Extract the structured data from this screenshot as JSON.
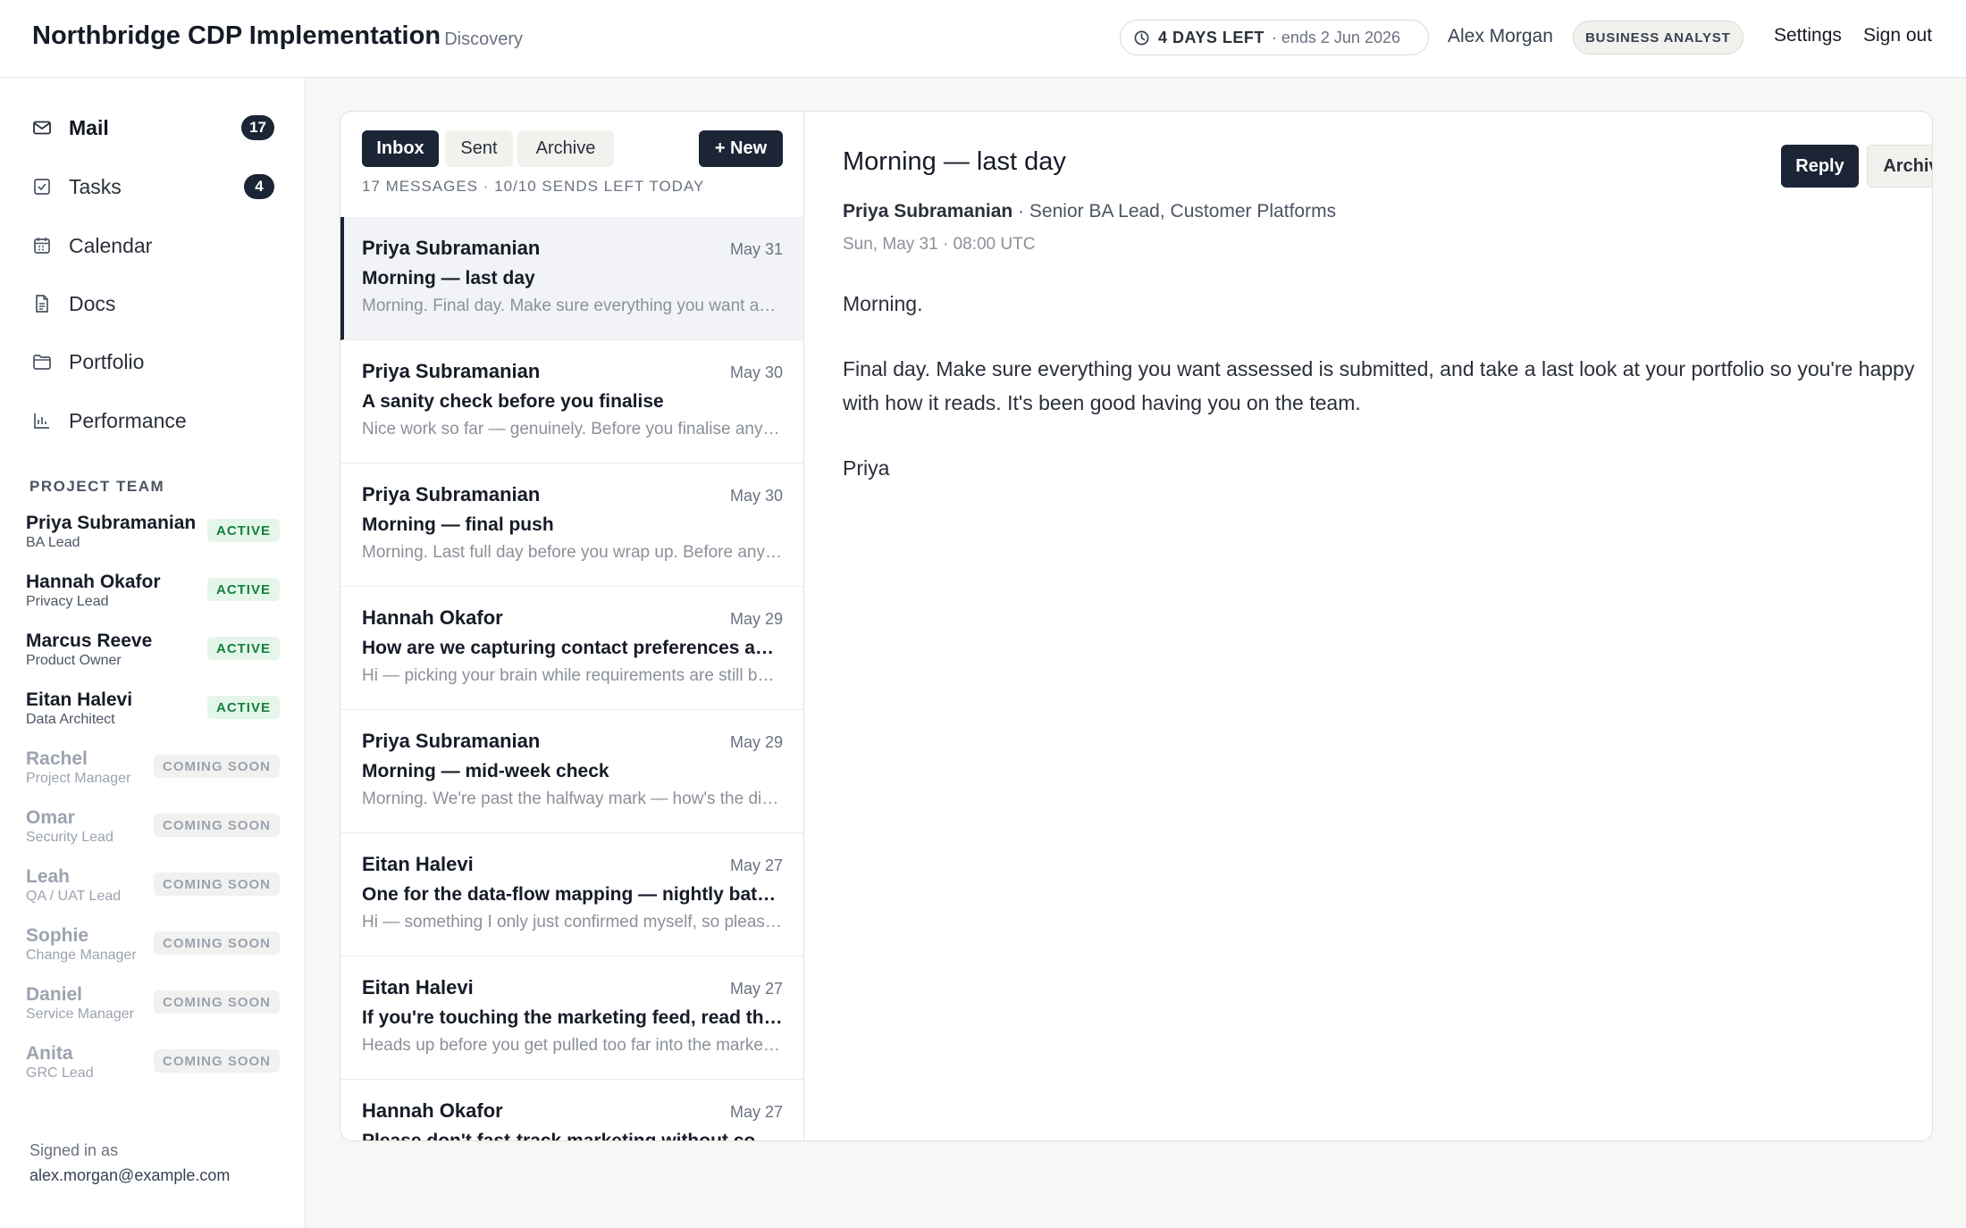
{
  "header": {
    "title": "Northbridge CDP Implementation",
    "subtitle": "· Discovery",
    "deadline_strong": "4 DAYS LEFT",
    "deadline_soft": "· ends 2 Jun 2026",
    "user": "Alex Morgan",
    "role": "BUSINESS ANALYST",
    "settings": "Settings",
    "signout": "Sign out"
  },
  "sidebar": {
    "nav": [
      {
        "label": "Mail",
        "badge": "17",
        "icon": "mail-icon"
      },
      {
        "label": "Tasks",
        "badge": "4",
        "icon": "checkbox-icon"
      },
      {
        "label": "Calendar",
        "icon": "calendar-icon"
      },
      {
        "label": "Docs",
        "icon": "document-icon"
      },
      {
        "label": "Portfolio",
        "icon": "folder-icon"
      },
      {
        "label": "Performance",
        "icon": "bar-chart-icon"
      }
    ],
    "team_heading": "PROJECT TEAM",
    "team": [
      {
        "name": "Priya Subramanian",
        "role": "BA Lead",
        "status": "ACTIVE"
      },
      {
        "name": "Hannah Okafor",
        "role": "Privacy Lead",
        "status": "ACTIVE"
      },
      {
        "name": "Marcus Reeve",
        "role": "Product Owner",
        "status": "ACTIVE"
      },
      {
        "name": "Eitan Halevi",
        "role": "Data Architect",
        "status": "ACTIVE"
      },
      {
        "name": "Rachel",
        "role": "Project Manager",
        "status": "COMING SOON"
      },
      {
        "name": "Omar",
        "role": "Security Lead",
        "status": "COMING SOON"
      },
      {
        "name": "Leah",
        "role": "QA / UAT Lead",
        "status": "COMING SOON"
      },
      {
        "name": "Sophie",
        "role": "Change Manager",
        "status": "COMING SOON"
      },
      {
        "name": "Daniel",
        "role": "Service Manager",
        "status": "COMING SOON"
      },
      {
        "name": "Anita",
        "role": "GRC Lead",
        "status": "COMING SOON"
      }
    ],
    "signed_label": "Signed in as",
    "signed_email": "alex.morgan@example.com"
  },
  "mail": {
    "tabs": [
      "Inbox",
      "Sent",
      "Archive"
    ],
    "new_label": "+ New",
    "meta": "17 MESSAGES · 10/10 SENDS LEFT TODAY",
    "messages": [
      {
        "from": "Priya Subramanian",
        "date": "May 31",
        "subject": "Morning — last day",
        "preview": "Morning. Final day. Make sure everything you want assessed is submitted"
      },
      {
        "from": "Priya Subramanian",
        "date": "May 30",
        "subject": "A sanity check before you finalise",
        "preview": "Nice work so far — genuinely. Before you finalise anything"
      },
      {
        "from": "Priya Subramanian",
        "date": "May 30",
        "subject": "Morning — final push",
        "preview": "Morning. Last full day before you wrap up. Before anything else"
      },
      {
        "from": "Hannah Okafor",
        "date": "May 29",
        "subject": "How are we capturing contact preferences across channels?",
        "preview": "Hi — picking your brain while requirements are still being shaped"
      },
      {
        "from": "Priya Subramanian",
        "date": "May 29",
        "subject": "Morning — mid-week check",
        "preview": "Morning. We're past the halfway mark — how's the discovery going"
      },
      {
        "from": "Eitan Halevi",
        "date": "May 27",
        "subject": "One for the data-flow mapping — nightly batch timing",
        "preview": "Hi — something I only just confirmed myself, so please factor it in"
      },
      {
        "from": "Eitan Halevi",
        "date": "May 27",
        "subject": "If you're touching the marketing feed, read this first",
        "preview": "Heads up before you get pulled too far into the marketing feed"
      },
      {
        "from": "Hannah Okafor",
        "date": "May 27",
        "subject": "Please don't fast-track marketing without consent",
        "preview": ""
      }
    ]
  },
  "reader": {
    "subject": "Morning — last day",
    "reply_label": "Reply",
    "archive_label": "Archive",
    "from_name": "Priya Subramanian",
    "from_title": " · Senior BA Lead, Customer Platforms",
    "date": "Sun, May 31 · 08:00 UTC",
    "body": [
      "Morning.",
      "Final day. Make sure everything you want assessed is submitted, and take a last look at your portfolio so you're happy with how it reads. It's been good having you on the team.",
      "Priya"
    ]
  }
}
